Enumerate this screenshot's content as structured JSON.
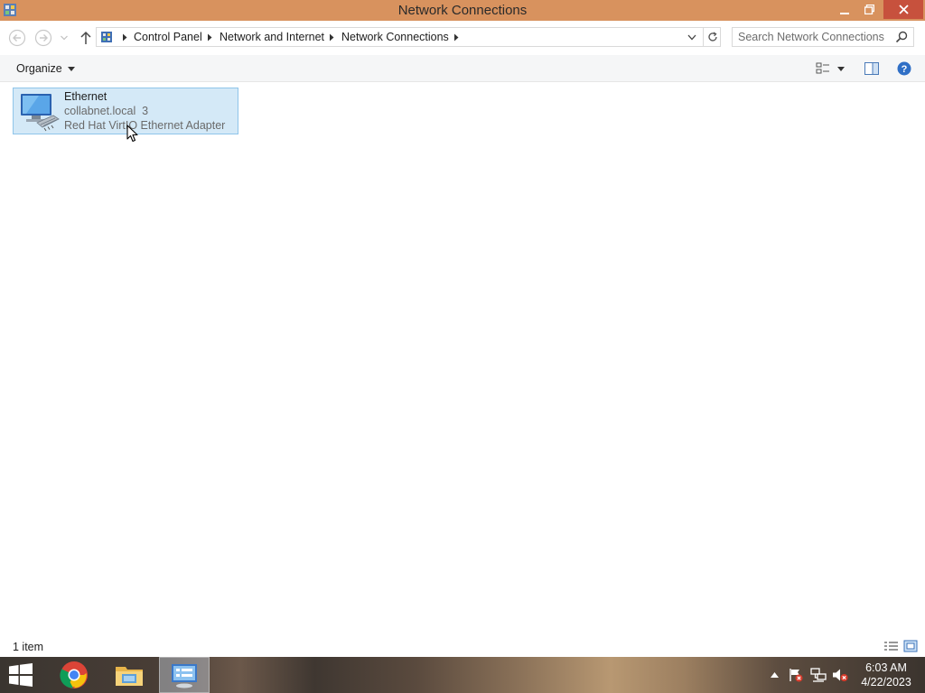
{
  "window": {
    "title": "Network Connections"
  },
  "address_bar": {
    "breadcrumbs": [
      "Control Panel",
      "Network and Internet",
      "Network Connections"
    ],
    "search_placeholder": "Search Network Connections"
  },
  "command_bar": {
    "organize_label": "Organize"
  },
  "connections": [
    {
      "name": "Ethernet",
      "network": "collabnet.local  3",
      "adapter": "Red Hat VirtIO Ethernet Adapter",
      "selected": true
    }
  ],
  "status_bar": {
    "item_count": "1 item"
  },
  "taskbar": {
    "time": "6:03 AM",
    "date": "4/22/2023",
    "pinned": [
      "start-icon",
      "chrome-icon",
      "file-explorer-icon",
      "network-connections-icon"
    ],
    "tray_icons": [
      "show-hidden-icons-icon",
      "action-center-flag-icon",
      "network-icon",
      "speaker-muted-icon"
    ]
  },
  "colors": {
    "titlebar": "#d8925e",
    "close_button": "#c7513d",
    "selection_fill": "#d4e9f7",
    "selection_border": "#8fc5ea"
  }
}
